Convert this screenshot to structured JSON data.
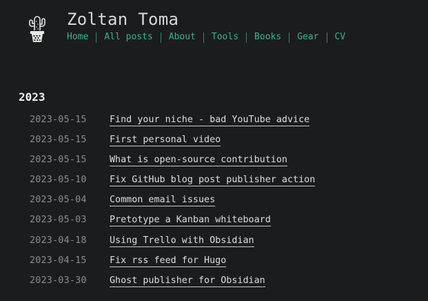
{
  "site": {
    "title": "Zoltan Toma"
  },
  "nav": [
    {
      "label": "Home"
    },
    {
      "label": "All posts"
    },
    {
      "label": "About"
    },
    {
      "label": "Tools"
    },
    {
      "label": "Books"
    },
    {
      "label": "Gear"
    },
    {
      "label": "CV"
    }
  ],
  "archive": {
    "year": "2023",
    "posts": [
      {
        "date": "2023-05-15",
        "title": "Find your niche - bad YouTube advice"
      },
      {
        "date": "2023-05-15",
        "title": "First personal video"
      },
      {
        "date": "2023-05-15",
        "title": "What is open-source contribution"
      },
      {
        "date": "2023-05-10",
        "title": "Fix GitHub blog post publisher action"
      },
      {
        "date": "2023-05-04",
        "title": "Common email issues"
      },
      {
        "date": "2023-05-03",
        "title": "Pretotype a Kanban whiteboard"
      },
      {
        "date": "2023-04-18",
        "title": "Using Trello with Obsidian"
      },
      {
        "date": "2023-04-15",
        "title": "Fix rss feed for Hugo"
      },
      {
        "date": "2023-03-30",
        "title": "Ghost publisher for Obsidian"
      }
    ]
  },
  "colors": {
    "background": "#1b1c1d",
    "nav_link": "#37b58a",
    "date_text": "#8a8d90",
    "post_link": "#dedede"
  },
  "icons": {
    "logo": "cactus-in-pot-icon"
  }
}
